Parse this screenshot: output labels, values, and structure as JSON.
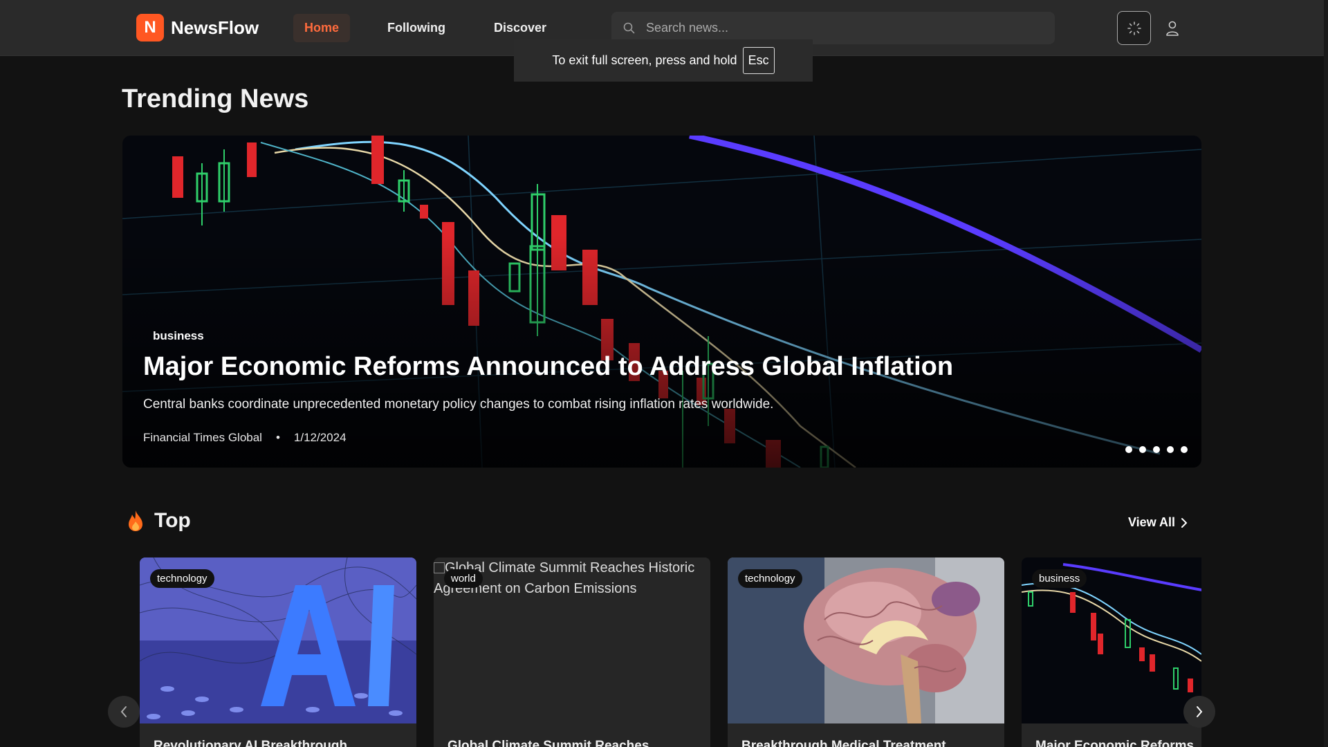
{
  "header": {
    "logo_letter": "N",
    "logo_text": "NewsFlow",
    "nav": [
      {
        "label": "Home",
        "active": true
      },
      {
        "label": "Following",
        "active": false
      },
      {
        "label": "Discover",
        "active": false
      }
    ],
    "search_placeholder": "Search news...",
    "theme_icon": "sun-icon",
    "user_icon": "user-icon"
  },
  "fullscreen_notice": {
    "text": "To exit full screen, press and hold",
    "key": "Esc"
  },
  "trending": {
    "title": "Trending News",
    "hero": {
      "tag": "business",
      "title": "Major Economic Reforms Announced to Address Global Inflation",
      "description": "Central banks coordinate unprecedented monetary policy changes to combat rising inflation rates worldwide.",
      "source": "Financial Times Global",
      "separator": "•",
      "date": "1/12/2024",
      "slide_count": 5
    }
  },
  "top": {
    "icon": "flame-icon",
    "title": "Top",
    "view_all": "View All",
    "cards": [
      {
        "tag": "technology",
        "title": "Revolutionary AI Breakthrough",
        "image": "ai-image",
        "alt": ""
      },
      {
        "tag": "world",
        "title": "Global Climate Summit Reaches",
        "image": "broken",
        "alt": "Global Climate Summit Reaches Historic Agreement on Carbon Emissions"
      },
      {
        "tag": "technology",
        "title": "Breakthrough Medical Treatment",
        "image": "brain-image",
        "alt": ""
      },
      {
        "tag": "business",
        "title": "Major Economic Reforms",
        "image": "chart-image",
        "alt": ""
      }
    ]
  },
  "colors": {
    "accent": "#ff5722",
    "background": "#121212",
    "header": "#2a2a2a",
    "card": "#262626"
  }
}
